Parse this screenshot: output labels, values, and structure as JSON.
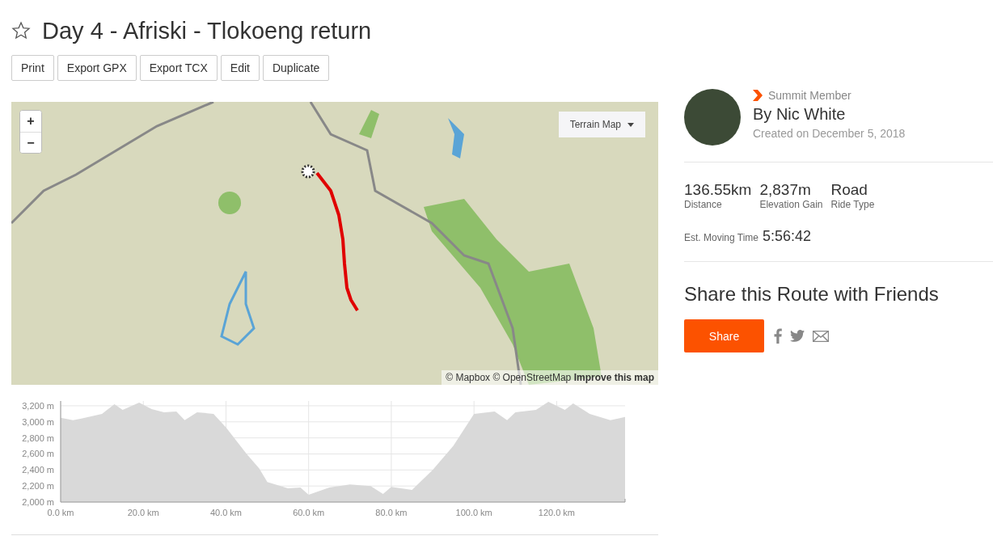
{
  "route": {
    "title": "Day 4 - Afriski - Tlokoeng return",
    "starred": false
  },
  "actions": [
    "Print",
    "Export GPX",
    "Export TCX",
    "Edit",
    "Duplicate"
  ],
  "map": {
    "zoom_in": "+",
    "zoom_out": "−",
    "layer_menu": "Terrain Map",
    "attribution": "© Mapbox © OpenStreetMap **Improve this map**"
  },
  "elevation": {
    "chart_data": {
      "type": "area",
      "xlim": [
        0,
        136.55
      ],
      "ylim": [
        2000,
        3260
      ],
      "grid": true,
      "x": [
        0,
        3,
        5,
        10,
        13,
        15,
        19,
        22,
        25,
        28,
        30,
        33,
        37,
        40,
        45,
        48,
        50,
        55,
        58,
        60,
        65,
        70,
        75,
        78,
        80,
        85,
        90,
        95,
        100,
        105,
        108,
        110,
        115,
        118,
        122,
        124,
        128,
        133,
        136.55
      ],
      "series": [
        {
          "color": "#d9d9d9",
          "values": [
            3050,
            3020,
            3040,
            3100,
            3220,
            3150,
            3240,
            3160,
            3120,
            3130,
            3020,
            3120,
            3100,
            2930,
            2600,
            2420,
            2250,
            2170,
            2180,
            2090,
            2180,
            2220,
            2200,
            2100,
            2190,
            2150,
            2400,
            2700,
            3100,
            3130,
            3020,
            3120,
            3150,
            3250,
            3150,
            3230,
            3100,
            3020,
            3060
          ]
        }
      ],
      "xticks": [
        {
          "value": 0,
          "label": "0.0 km"
        },
        {
          "value": 20,
          "label": "20.0 km"
        },
        {
          "value": 40,
          "label": "40.0 km"
        },
        {
          "value": 60,
          "label": "60.0 km"
        },
        {
          "value": 80,
          "label": "80.0 km"
        },
        {
          "value": 100,
          "label": "100.0 km"
        },
        {
          "value": 120,
          "label": "120.0 km"
        }
      ],
      "yticks": [
        {
          "value": 2000,
          "label": "2,000 m"
        },
        {
          "value": 2200,
          "label": "2,200 m"
        },
        {
          "value": 2400,
          "label": "2,400 m"
        },
        {
          "value": 2600,
          "label": "2,600 m"
        },
        {
          "value": 2800,
          "label": "2,800 m"
        },
        {
          "value": 3000,
          "label": "3,000 m"
        },
        {
          "value": 3200,
          "label": "3,200 m"
        }
      ]
    }
  },
  "author": {
    "membership": "Summit Member",
    "name": "By Nic White",
    "created": "Created on December 5, 2018"
  },
  "stats": [
    {
      "value": "136.55km",
      "label": "Distance"
    },
    {
      "value": "2,837m",
      "label": "Elevation Gain"
    },
    {
      "value": "Road",
      "label": "Ride Type"
    }
  ],
  "moving_time": {
    "label": "Est. Moving Time",
    "value": "5:56:42"
  },
  "share": {
    "heading": "Share this Route with Friends",
    "button": "Share"
  }
}
